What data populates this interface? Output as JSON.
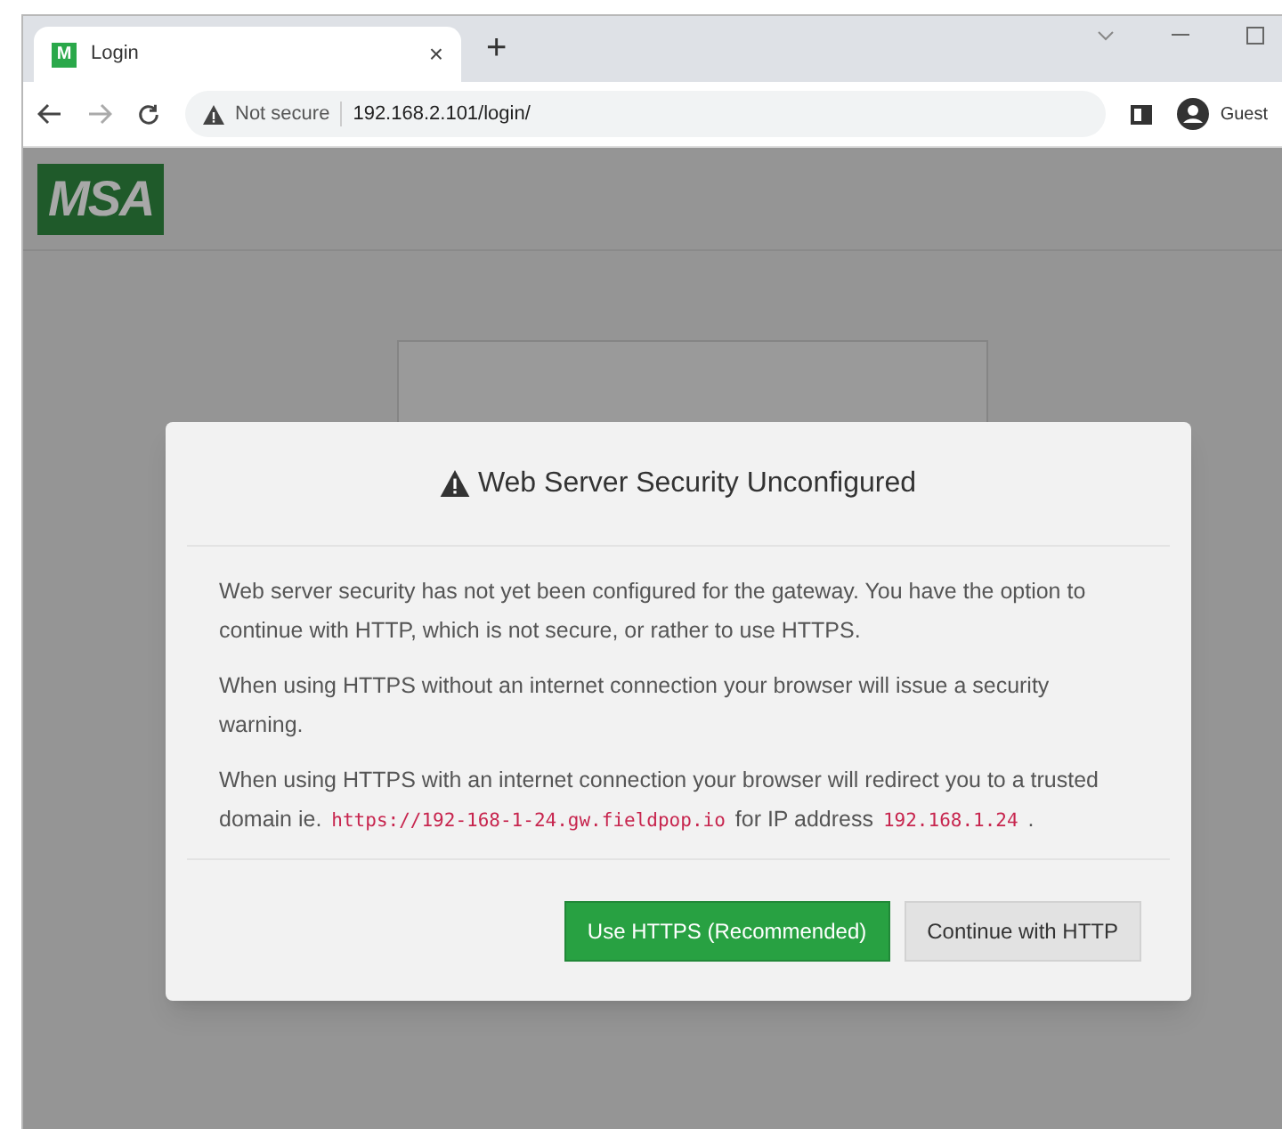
{
  "browser": {
    "tab": {
      "favicon": "M",
      "title": "Login",
      "close": "×"
    },
    "new_tab": "+",
    "address": {
      "security": "Not secure",
      "url": "192.168.2.101/login/"
    },
    "profile": "Guest"
  },
  "page": {
    "logo": "MSA"
  },
  "dialog": {
    "title": "Web Server Security Unconfigured",
    "paragraphs": [
      [
        {
          "kind": "text",
          "text": "Web server security has not yet been configured for the gateway. You have the option to continue with HTTP, which is not secure, or rather to use HTTPS."
        }
      ],
      [
        {
          "kind": "text",
          "text": "When using HTTPS without an internet connection your browser will issue a security warning."
        }
      ],
      [
        {
          "kind": "text",
          "text": "When using HTTPS with an internet connection your browser will redirect you to a trusted domain ie. "
        },
        {
          "kind": "code",
          "text": "https://192-168-1-24.gw.fieldpop.io"
        },
        {
          "kind": "text",
          "text": " for IP address "
        },
        {
          "kind": "code",
          "text": "192.168.1.24"
        },
        {
          "kind": "text",
          "text": " ."
        }
      ]
    ],
    "buttons": [
      {
        "label": "Use HTTPS (Recommended)",
        "kind": "primary"
      },
      {
        "label": "Continue with HTTP",
        "kind": "default"
      }
    ]
  }
}
